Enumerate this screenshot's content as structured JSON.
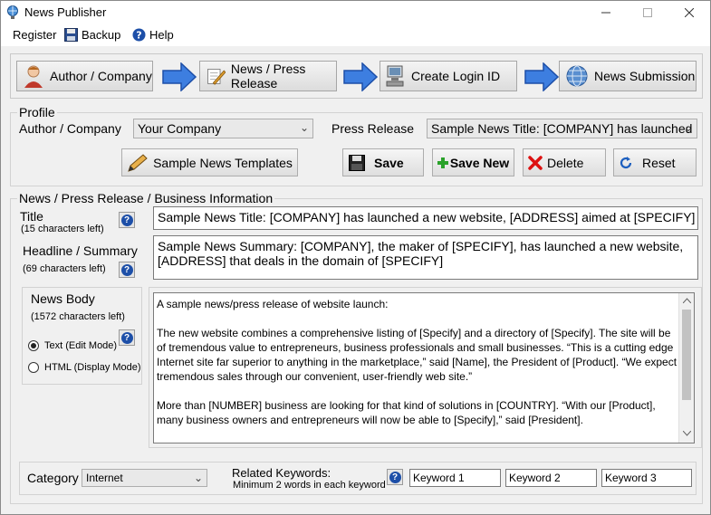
{
  "window": {
    "title": "News Publisher"
  },
  "menu": {
    "register": "Register",
    "backup": "Backup",
    "help": "Help"
  },
  "steps": [
    {
      "label": "Author / Company"
    },
    {
      "label": "News / Press Release"
    },
    {
      "label": "Create Login ID"
    },
    {
      "label": "News Submission"
    }
  ],
  "profile": {
    "legend": "Profile",
    "author_label": "Author / Company",
    "author_value": "Your Company",
    "press_label": "Press Release",
    "press_value": "Sample News Title: [COMPANY] has launched",
    "templates_button": "Sample News Templates",
    "save_button": "Save",
    "save_new_button": "Save New",
    "delete_button": "Delete",
    "reset_button": "Reset"
  },
  "info": {
    "legend": "News / Press Release / Business Information",
    "title_label": "Title",
    "title_count": "(15 characters left)",
    "title_value": "Sample News Title: [COMPANY] has launched a new website, [ADDRESS] aimed at [SPECIFY]",
    "headline_label": "Headline / Summary",
    "headline_count": "(69 characters left)",
    "headline_value": "Sample News Summary: [COMPANY], the maker of [SPECIFY], has launched a new website, [ADDRESS] that deals in the domain of [SPECIFY]",
    "body_label": "News Body",
    "body_count": "(1572 characters left)",
    "mode_text": "Text (Edit Mode)",
    "mode_html": "HTML (Display Mode)",
    "mode_selected": "Text (Edit Mode)",
    "body_p1": "A sample news/press release of website launch:",
    "body_p2": "The new website combines a comprehensive listing of [Specify] and a directory of [Specify]. The site will be of tremendous value to entrepreneurs, business professionals and small businesses. “This is a cutting edge Internet site far superior to anything in the marketplace,” said [Name], the President of [Product]. “We expect tremendous sales through our convenient, user-friendly web site.”",
    "body_p3": "More than [NUMBER] business are looking for that kind of solutions in [COUNTRY]. “With our [Product], many business owners and entrepreneurs will now be able to [Specify],” said [President]."
  },
  "footer": {
    "category_label": "Category",
    "category_value": "Internet",
    "keywords_label": "Related Keywords:",
    "keywords_hint": "Minimum 2 words in each keyword",
    "keyword1": "Keyword 1",
    "keyword2": "Keyword 2",
    "keyword3": "Keyword 3"
  }
}
